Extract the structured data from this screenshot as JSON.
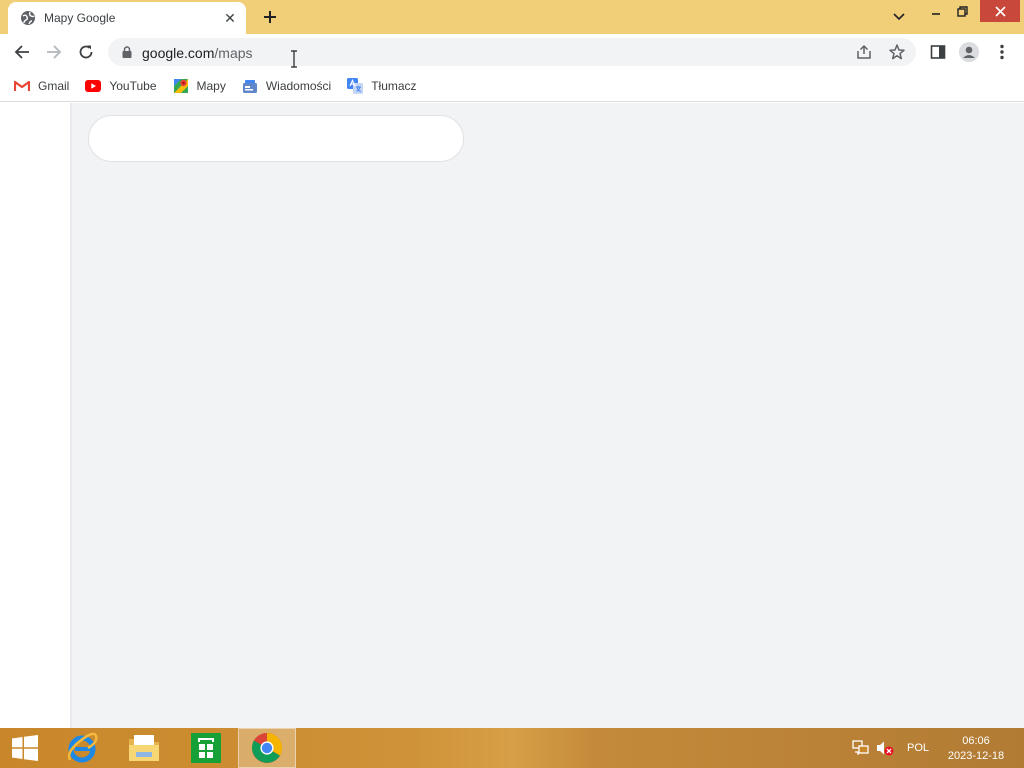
{
  "tab": {
    "title": "Mapy Google",
    "favicon": "globe-icon",
    "close_glyph": "✕"
  },
  "toolbar": {
    "url_host": "google.com",
    "url_path": "/maps"
  },
  "bookmarks": [
    {
      "label": "Gmail",
      "icon": "gmail-icon"
    },
    {
      "label": "YouTube",
      "icon": "youtube-icon"
    },
    {
      "label": "Mapy",
      "icon": "maps-icon"
    },
    {
      "label": "Wiadomości",
      "icon": "news-icon"
    },
    {
      "label": "Tłumacz",
      "icon": "translate-icon"
    }
  ],
  "taskbar": {
    "apps": [
      "windows-start",
      "internet-explorer",
      "file-explorer",
      "windows-store",
      "google-chrome"
    ],
    "language": "POL",
    "time": "06:06",
    "date": "2023-12-18"
  },
  "colors": {
    "title_bar": "#f0cf78",
    "close_button": "#c9483c",
    "page_background": "#f1f3f5",
    "taskbar": "#c8872a"
  }
}
